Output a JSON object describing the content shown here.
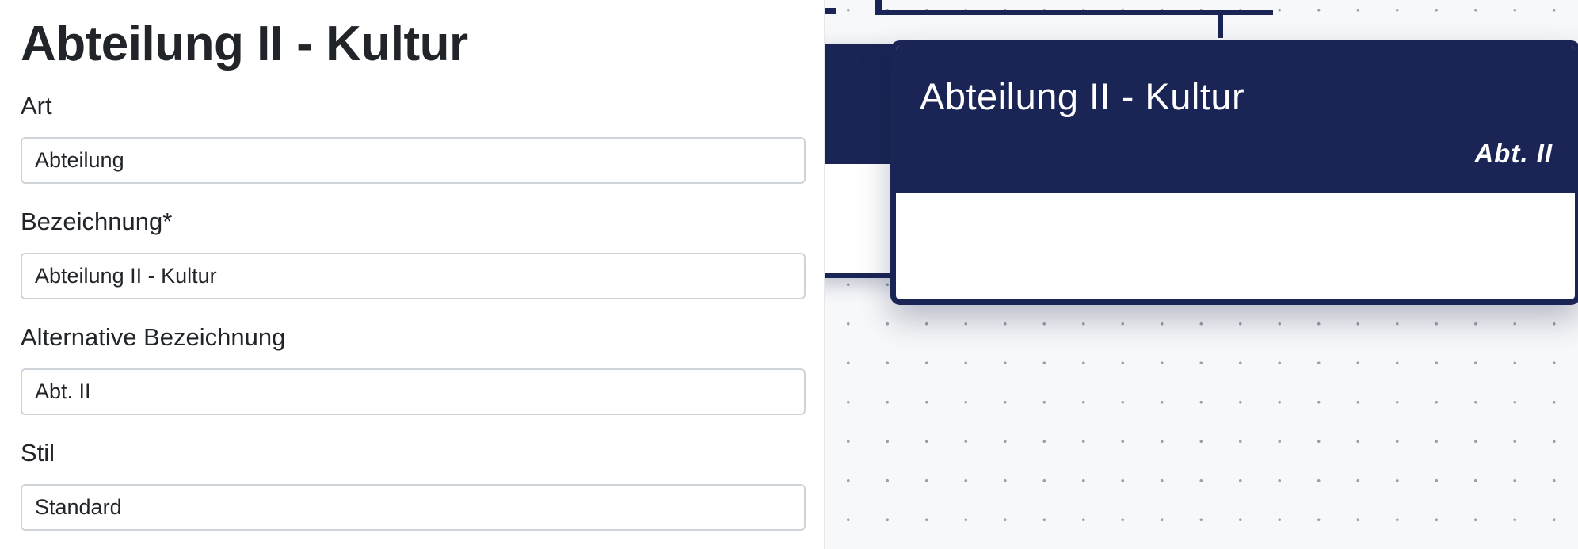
{
  "form": {
    "title": "Abteilung II - Kultur",
    "fields": [
      {
        "label": "Art",
        "value": "Abteilung"
      },
      {
        "label": "Bezeichnung*",
        "value": "Abteilung II - Kultur"
      },
      {
        "label": "Alternative Bezeichnung",
        "value": "Abt. II"
      },
      {
        "label": "Stil",
        "value": "Standard"
      }
    ]
  },
  "canvas": {
    "selected_node": {
      "title": "Abteilung II - Kultur",
      "alt_label": "Abt. II",
      "header_color": "#1a2555"
    }
  },
  "colors": {
    "accent": "#1a2555",
    "input_border": "#ced4da",
    "canvas_bg": "#f7f8fa"
  }
}
